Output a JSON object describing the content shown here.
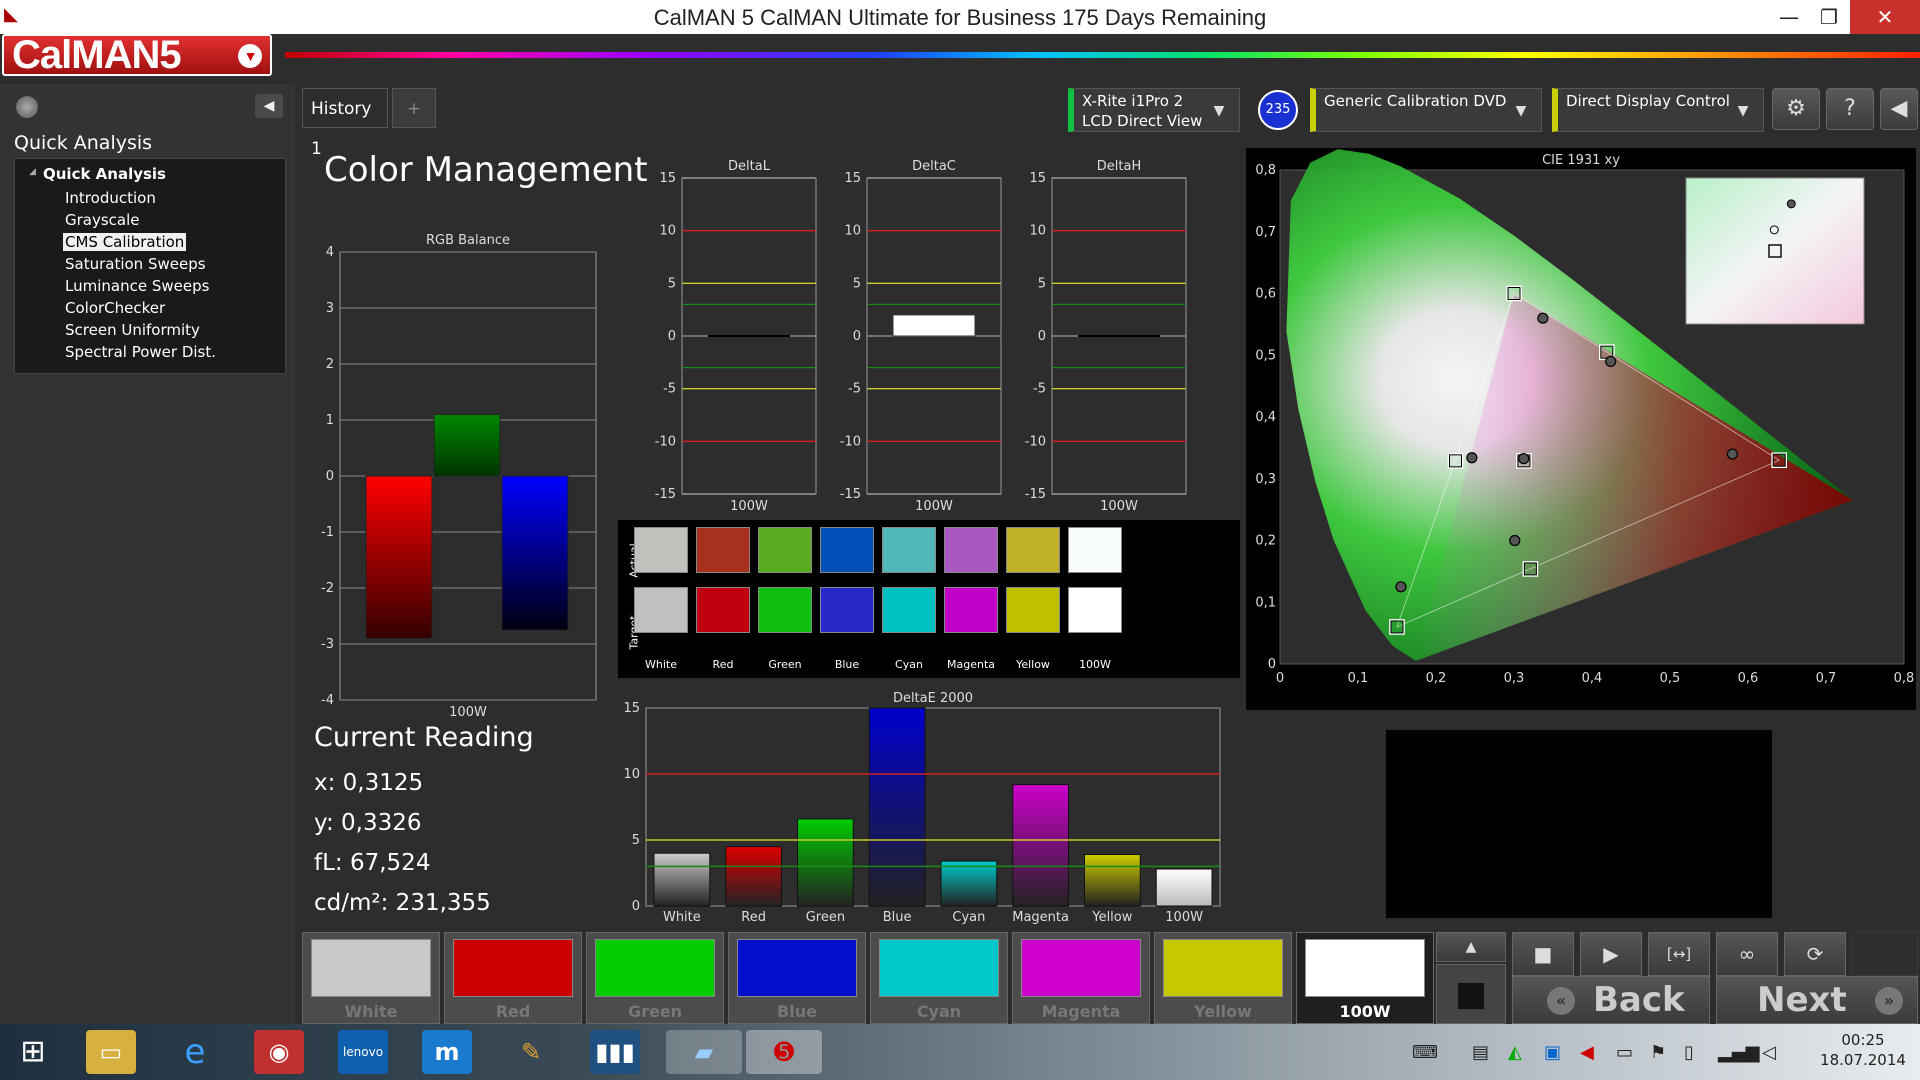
{
  "window": {
    "title": "CalMAN 5 CalMAN Ultimate for Business 175 Days Remaining",
    "minimize": "—",
    "restore": "❐",
    "close": "✕"
  },
  "logo": {
    "text": "CalMAN5",
    "dropdown": "▼"
  },
  "sidebar": {
    "title": "Quick Analysis",
    "tree_head": "Quick Analysis",
    "items": [
      {
        "label": "Introduction",
        "selected": false
      },
      {
        "label": "Grayscale",
        "selected": false
      },
      {
        "label": "CMS Calibration",
        "selected": true
      },
      {
        "label": "Saturation Sweeps",
        "selected": false
      },
      {
        "label": "Luminance Sweeps",
        "selected": false
      },
      {
        "label": "ColorChecker",
        "selected": false
      },
      {
        "label": "Screen Uniformity",
        "selected": false
      },
      {
        "label": "Spectral Power Dist.",
        "selected": false
      }
    ],
    "collapse_icon": "◀"
  },
  "tabs": {
    "history": "History 1",
    "add": "+"
  },
  "devices": {
    "meter_line1": "X-Rite i1Pro 2",
    "meter_line2": "LCD Direct View",
    "meter_badge": "235",
    "source": "Generic Calibration DVD",
    "display": "Direct Display Control",
    "drop": "▼"
  },
  "toolbar": {
    "settings_icon": "⚙",
    "help_icon": "?",
    "back_icon": "◀"
  },
  "page_title": "Color Management",
  "current_reading": {
    "title": "Current Reading",
    "x": "x: 0,3125",
    "y": "y: 0,3326",
    "fl": "fL: 67,524",
    "cdm2": "cd/m²: 231,355"
  },
  "swatches": {
    "actual_label": "Actual",
    "target_label": "Target",
    "items": [
      {
        "name": "White",
        "actual": "#c0c0bd",
        "target": "#c0c0c0"
      },
      {
        "name": "Red",
        "actual": "#a8301e",
        "target": "#c00010"
      },
      {
        "name": "Green",
        "actual": "#58aa1e",
        "target": "#10c010"
      },
      {
        "name": "Blue",
        "actual": "#0050b8",
        "target": "#2828c8"
      },
      {
        "name": "Cyan",
        "actual": "#50b8b8",
        "target": "#00c0c0"
      },
      {
        "name": "Magenta",
        "actual": "#a858c0",
        "target": "#c000c8"
      },
      {
        "name": "Yellow",
        "actual": "#c0b028",
        "target": "#c0c000"
      },
      {
        "name": "100W",
        "actual": "#f8fcfa",
        "target": "#ffffff"
      }
    ]
  },
  "patch_buttons": [
    {
      "label": "White",
      "color": "#c8c8c8",
      "active": false
    },
    {
      "label": "Red",
      "color": "#cc0000",
      "active": false
    },
    {
      "label": "Green",
      "color": "#00cc00",
      "active": false
    },
    {
      "label": "Blue",
      "color": "#0010cc",
      "active": false
    },
    {
      "label": "Cyan",
      "color": "#00c8c8",
      "active": false
    },
    {
      "label": "Magenta",
      "color": "#cc00cc",
      "active": false
    },
    {
      "label": "Yellow",
      "color": "#c8c800",
      "active": false
    },
    {
      "label": "100W",
      "color": "#ffffff",
      "active": true
    }
  ],
  "controls": {
    "up": "▲",
    "stop": "■",
    "play": "▶",
    "fit": "[↔]",
    "loop": "∞",
    "refresh": "⟳",
    "record": "■",
    "back": "Back",
    "next": "Next",
    "back_ar": "«",
    "next_ar": "»"
  },
  "taskbar": {
    "clock_time": "00:25",
    "clock_date": "18.07.2014"
  },
  "chart_data": [
    {
      "type": "bar",
      "title": "RGB Balance",
      "categories": [
        "100W"
      ],
      "series": [
        {
          "name": "Red",
          "values": [
            -2.9
          ],
          "color": "#ff0000"
        },
        {
          "name": "Green",
          "values": [
            1.1
          ],
          "color": "#008800"
        },
        {
          "name": "Blue",
          "values": [
            -2.75
          ],
          "color": "#0000ff"
        }
      ],
      "xlabel": "100W",
      "ylim": [
        -4,
        4
      ],
      "yticks": [
        "4",
        "3",
        "2",
        "1",
        "0",
        "-1",
        "-2",
        "-3",
        "-4"
      ]
    },
    {
      "type": "bar",
      "title": "DeltaL",
      "categories": [
        "100W"
      ],
      "values": [
        0
      ],
      "ylim": [
        -15,
        15
      ],
      "yticks": [
        "15",
        "10",
        "5",
        "0",
        "-5",
        "-10",
        "-15"
      ],
      "xlabel": "100W"
    },
    {
      "type": "bar",
      "title": "DeltaC",
      "categories": [
        "100W"
      ],
      "values": [
        2
      ],
      "ylim": [
        -15,
        15
      ],
      "yticks": [
        "15",
        "10",
        "5",
        "0",
        "-5",
        "-10",
        "-15"
      ],
      "xlabel": "100W"
    },
    {
      "type": "bar",
      "title": "DeltaH",
      "categories": [
        "100W"
      ],
      "values": [
        0
      ],
      "ylim": [
        -15,
        15
      ],
      "yticks": [
        "15",
        "10",
        "5",
        "0",
        "-5",
        "-10",
        "-15"
      ],
      "xlabel": "100W"
    },
    {
      "type": "bar",
      "title": "DeltaE 2000",
      "categories": [
        "White",
        "Red",
        "Green",
        "Blue",
        "Cyan",
        "Magenta",
        "Yellow",
        "100W"
      ],
      "values": [
        4,
        4.5,
        6.6,
        15,
        3.4,
        9.2,
        3.9,
        2.8
      ],
      "colors": [
        "#cccccc",
        "#dd0000",
        "#00cc00",
        "#0000cc",
        "#00cccc",
        "#cc00cc",
        "#cccc00",
        "#ffffff"
      ],
      "ylim": [
        0,
        15
      ],
      "yticks": [
        "15",
        "10",
        "5",
        "0"
      ]
    },
    {
      "type": "scatter",
      "title": "CIE 1931 xy",
      "xticks": [
        "0",
        "0,1",
        "0,2",
        "0,3",
        "0,4",
        "0,5",
        "0,6",
        "0,7",
        "0,8"
      ],
      "yticks": [
        "0",
        "0,1",
        "0,2",
        "0,3",
        "0,4",
        "0,5",
        "0,6",
        "0,7",
        "0,8"
      ],
      "xlim": [
        0,
        0.8
      ],
      "ylim": [
        0,
        0.8
      ],
      "targets": [
        {
          "x": 0.3,
          "y": 0.6
        },
        {
          "x": 0.64,
          "y": 0.33
        },
        {
          "x": 0.15,
          "y": 0.06
        },
        {
          "x": 0.225,
          "y": 0.329
        },
        {
          "x": 0.321,
          "y": 0.154
        },
        {
          "x": 0.419,
          "y": 0.505
        },
        {
          "x": 0.3127,
          "y": 0.329
        }
      ],
      "measured": [
        {
          "x": 0.337,
          "y": 0.56
        },
        {
          "x": 0.58,
          "y": 0.34
        },
        {
          "x": 0.155,
          "y": 0.125
        },
        {
          "x": 0.246,
          "y": 0.334
        },
        {
          "x": 0.301,
          "y": 0.2
        },
        {
          "x": 0.424,
          "y": 0.49
        },
        {
          "x": 0.3125,
          "y": 0.3326
        }
      ]
    }
  ]
}
